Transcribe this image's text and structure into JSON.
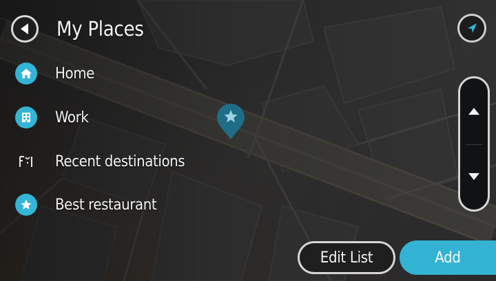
{
  "header": {
    "title": "My Places"
  },
  "places": [
    {
      "label": "Home",
      "icon": "home-icon"
    },
    {
      "label": "Work",
      "icon": "work-icon"
    },
    {
      "label": "Recent destinations",
      "icon": "flag-route-icon"
    },
    {
      "label": "Best restaurant",
      "icon": "star-icon"
    }
  ],
  "footer": {
    "edit_label": "Edit List",
    "add_label": "Add"
  },
  "colors": {
    "accent": "#33b5d6",
    "map_background": "#2b2b2c",
    "text": "#f2f2f2"
  }
}
